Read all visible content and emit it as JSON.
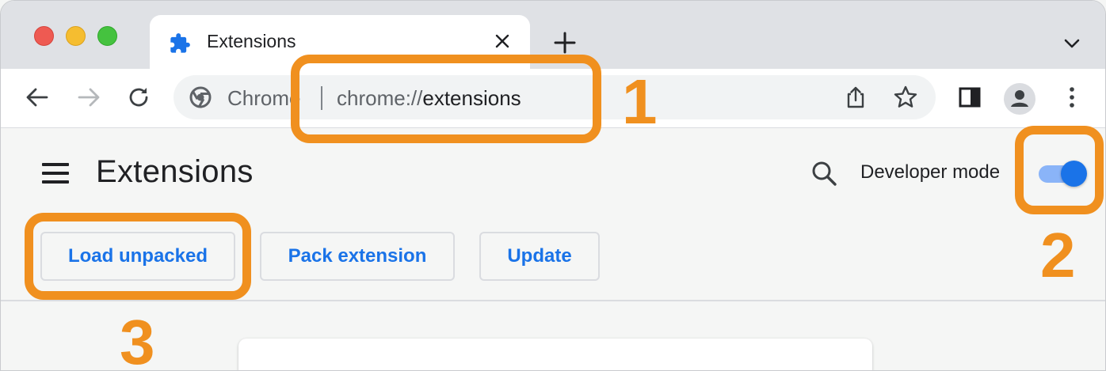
{
  "tab": {
    "title": "Extensions",
    "icon": "puzzle-piece-icon"
  },
  "omnibox": {
    "chip": "Chrome",
    "url_scheme": "chrome://",
    "url_host": "extensions"
  },
  "page": {
    "title": "Extensions",
    "developer_mode_label": "Developer mode",
    "developer_mode_on": true
  },
  "actions": {
    "load_unpacked": "Load unpacked",
    "pack_extension": "Pack extension",
    "update": "Update"
  },
  "annotations": {
    "step1": "1",
    "step2": "2",
    "step3": "3"
  },
  "colors": {
    "accent": "#1a73e8",
    "annotation": "#f0901f",
    "toggle_track": "#8ab4f8"
  }
}
